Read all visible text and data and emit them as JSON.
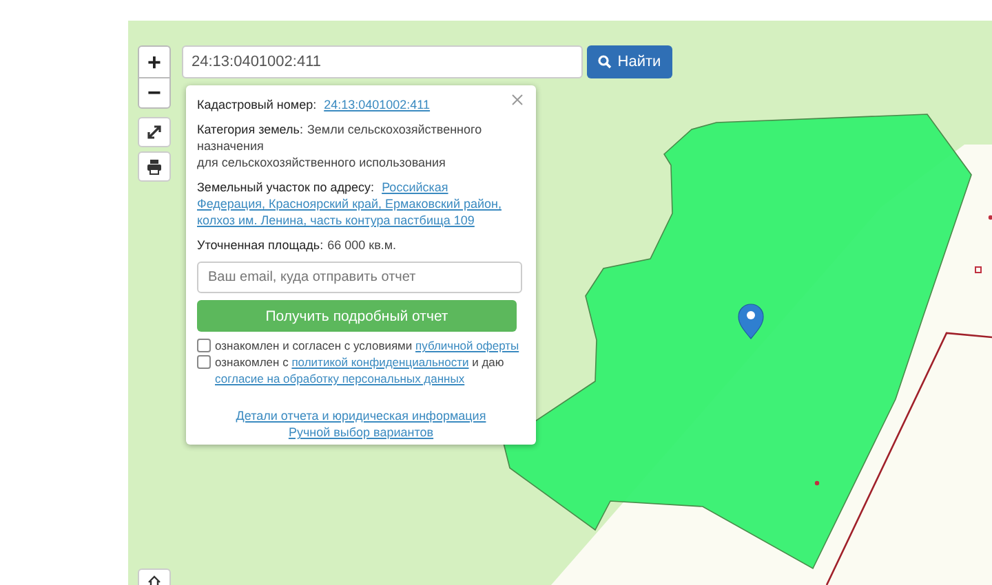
{
  "zoom_controls": [
    {
      "label": "+"
    },
    {
      "label": "−"
    }
  ],
  "search": {
    "value": "24:13:0401002:411",
    "button": "Найти"
  },
  "popup": {
    "fields": [
      {
        "kind": "link",
        "label": "Кадастровый номер:",
        "lines": [
          "24:13:0401002:411"
        ]
      },
      {
        "kind": "text",
        "label": "Категория земель:",
        "lines": [
          "Земли сельскохозяйственного назначения",
          "для сельскохозяйственного использования"
        ]
      },
      {
        "kind": "link",
        "label": "Земельный участок по адресу:",
        "lines": [
          "Российская",
          "Федерация, Красноярский край, Ермаковский район,",
          "колхоз им. Ленина, часть контура пастбища 109"
        ]
      },
      {
        "kind": "text",
        "label": "Уточненная площадь:",
        "lines": [
          "66 000 кв.м."
        ]
      }
    ],
    "email_placeholder": "Ваш email, куда отправить отчет",
    "report_button": "Получить подробный отчет",
    "consents": [
      {
        "checked": false,
        "parts": [
          {
            "text": "ознакомлен и согласен с условиями ",
            "link": false
          },
          {
            "text": "публичной оферты",
            "link": true
          }
        ]
      },
      {
        "checked": false,
        "parts": [
          {
            "text": "ознакомлен с ",
            "link": false
          },
          {
            "text": "политикой конфиденциальности",
            "link": true
          },
          {
            "text": " и даю ",
            "link": false
          },
          {
            "text": "согласие на обработку персональных данных",
            "link": true
          }
        ]
      }
    ],
    "links": [
      "Детали отчета и юридическая информация",
      "Ручной выбор вариантов"
    ]
  }
}
